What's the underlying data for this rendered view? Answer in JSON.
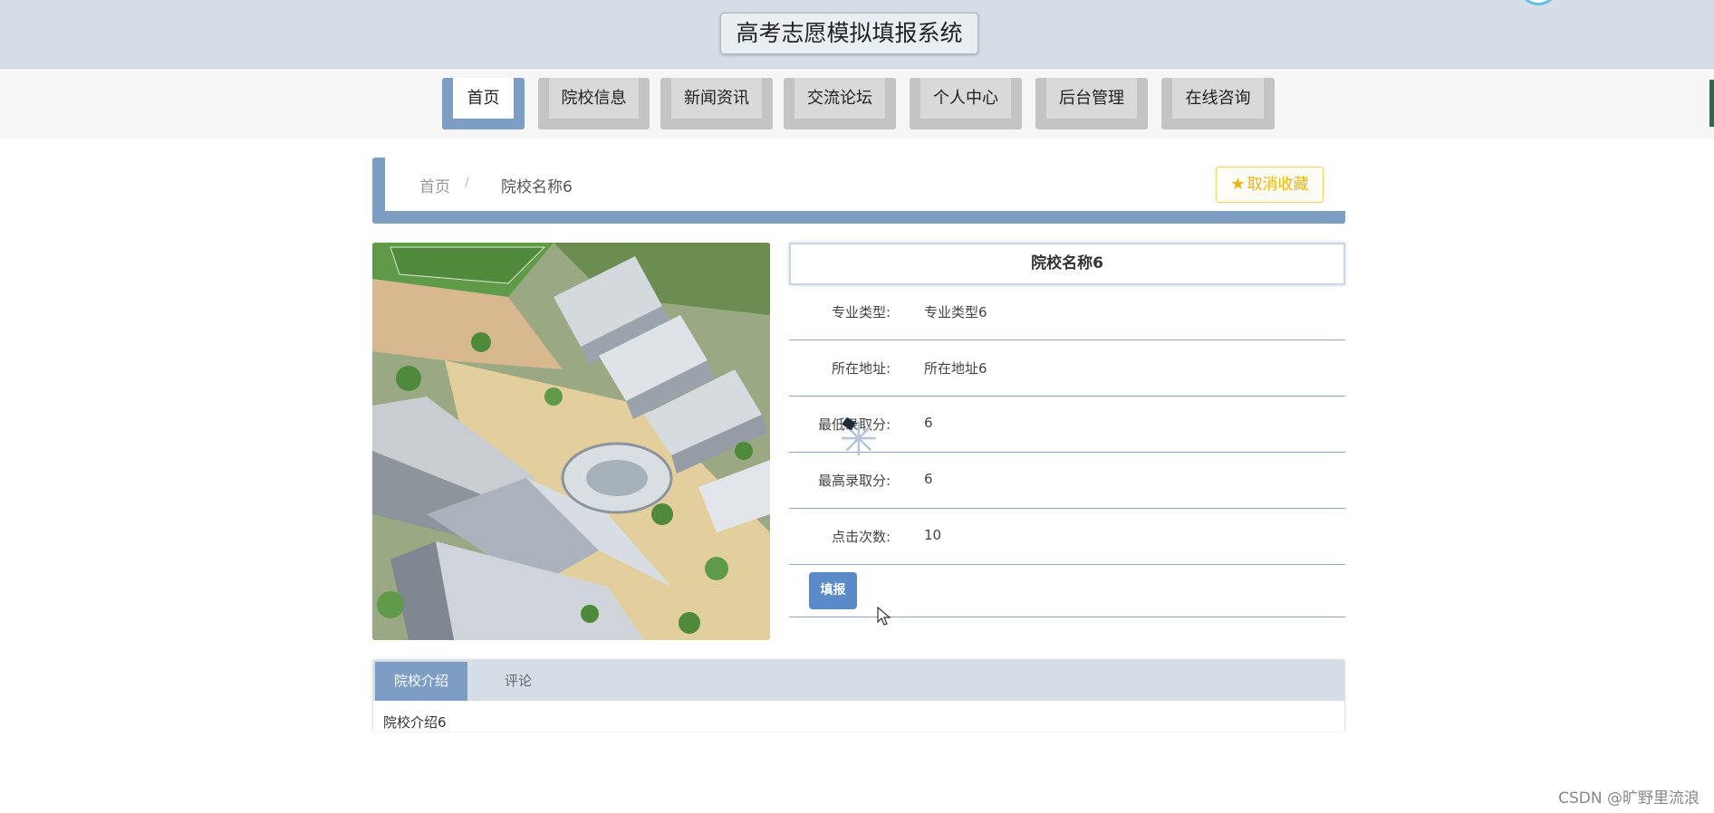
{
  "header": {
    "title": "高考志愿模拟填报系统"
  },
  "nav": {
    "items": [
      "首页",
      "院校信息",
      "新闻资讯",
      "交流论坛",
      "个人中心",
      "后台管理",
      "在线咨询"
    ],
    "active": "首页"
  },
  "breadcrumb": {
    "home": "首页",
    "separator": "/",
    "current": "院校名称6"
  },
  "favorite": {
    "label": "取消收藏",
    "icon": "star-icon",
    "color": "#f0b400"
  },
  "detail": {
    "title": "院校名称6",
    "fields": [
      {
        "label": "专业类型:",
        "value": "专业类型6"
      },
      {
        "label": "所在地址:",
        "value": "所在地址6"
      },
      {
        "label": "最低录取分:",
        "value": "6"
      },
      {
        "label": "最高录取分:",
        "value": "6"
      },
      {
        "label": "点击次数:",
        "value": "10"
      }
    ],
    "submit_label": "填报"
  },
  "tabs": {
    "items": [
      "院校介绍",
      "评论"
    ],
    "active": "院校介绍",
    "content": "院校介绍6"
  },
  "watermark": "CSDN @旷野里流浪",
  "colors": {
    "accent": "#7d9dc5",
    "header_bg": "#d5dee7",
    "button": "#5a8ac8"
  }
}
